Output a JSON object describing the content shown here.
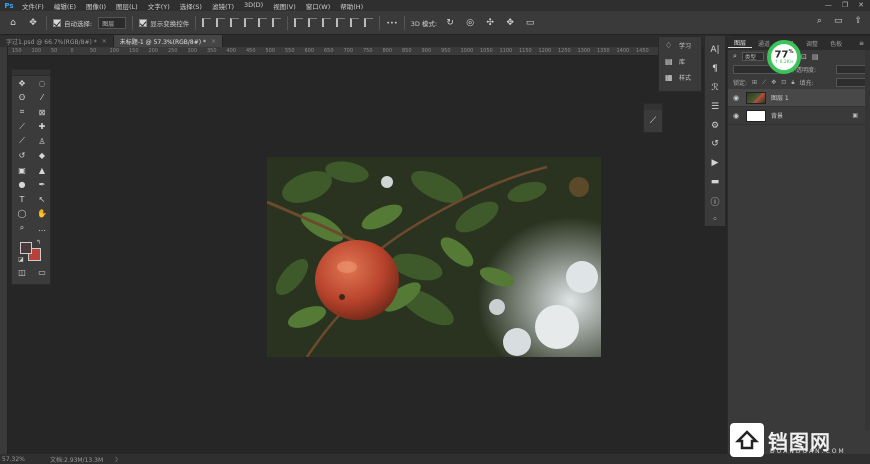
{
  "app": {
    "logo": "Ps",
    "menu": [
      "文件(F)",
      "编辑(E)",
      "图像(I)",
      "图层(L)",
      "文字(Y)",
      "选择(S)",
      "滤镜(T)",
      "3D(D)",
      "视图(V)",
      "窗口(W)",
      "帮助(H)"
    ],
    "window_controls": [
      "—",
      "❐",
      "✕"
    ]
  },
  "options_bar": {
    "auto_select_label": "自动选择:",
    "auto_select_value": "图层",
    "show_transform_label": "显示变换控件",
    "more_label": "•••"
  },
  "tabs": [
    {
      "label": "字过1.psd @ 66.7%(RGB/8#) *",
      "close": "×",
      "active": false
    },
    {
      "label": "未标题-1 @ 57.3%(RGB/8#) *",
      "close": "×",
      "active": true
    }
  ],
  "ruler": {
    "ticks": [
      "150",
      "100",
      "50",
      "0",
      "50",
      "100",
      "150",
      "200",
      "250",
      "300",
      "350",
      "400",
      "450",
      "500",
      "550",
      "600",
      "650",
      "700",
      "750",
      "800",
      "850",
      "900",
      "950",
      "1000",
      "1050",
      "1100",
      "1150",
      "1200",
      "1250",
      "1300",
      "1350",
      "1400",
      "1450"
    ]
  },
  "tools": [
    "move",
    "artboard",
    "lasso",
    "magic-wand",
    "crop",
    "frame",
    "eyedropper",
    "healing",
    "brush",
    "stamp",
    "history-brush",
    "eraser",
    "gradient",
    "blur",
    "dodge",
    "pen",
    "type",
    "path-select",
    "ellipse",
    "hand",
    "zoom",
    "more"
  ],
  "colors": {
    "foreground": "#4a3a3a",
    "background": "#b8423a"
  },
  "mini_panel": {
    "items": [
      {
        "icon": "lightbulb-icon",
        "label": "学习"
      },
      {
        "icon": "library-icon",
        "label": "库"
      },
      {
        "icon": "styles-icon",
        "label": "样式"
      }
    ]
  },
  "layers_panel": {
    "tabs": [
      "图层",
      "通道",
      "路径",
      "调整",
      "色板"
    ],
    "filter_label": "类型",
    "opacity_label": "不透明度:",
    "lock_label": "锁定:",
    "fill_label": "填充:",
    "layers": [
      {
        "name": "图层 1",
        "thumb": "photo",
        "selected": true,
        "locked": false
      },
      {
        "name": "背景",
        "thumb": "white",
        "selected": false,
        "locked": true
      }
    ]
  },
  "cpu_badge": {
    "percent": "77",
    "unit": "%",
    "speed": "↑ 0.2K/s"
  },
  "status": {
    "zoom": "57.32%",
    "doc": "文档:2.93M/13.3M",
    "arrow": "〉"
  },
  "watermark": {
    "cn": "铛图网",
    "en": "DOANDOAN.COM"
  }
}
